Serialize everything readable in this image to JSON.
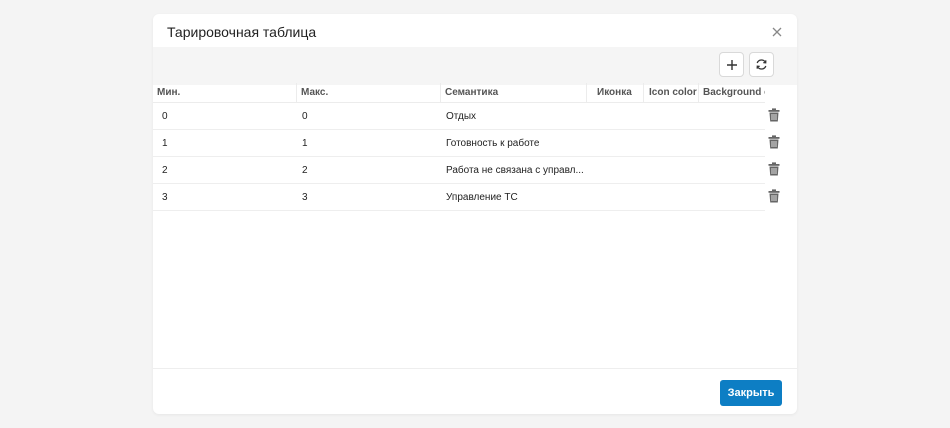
{
  "dialog": {
    "title": "Тарировочная таблица",
    "close_button_label": "Закрыть"
  },
  "toolbar": {
    "add_icon": "plus-icon",
    "refresh_icon": "refresh-icon"
  },
  "table": {
    "columns": [
      "Мин.",
      "Макс.",
      "Семантика",
      "Иконка",
      "Icon color",
      "Background c"
    ],
    "rows": [
      {
        "min": "0",
        "max": "0",
        "semantic": "Отдых"
      },
      {
        "min": "1",
        "max": "1",
        "semantic": "Готовность к работе"
      },
      {
        "min": "2",
        "max": "2",
        "semantic": "Работа не связана с управл..."
      },
      {
        "min": "3",
        "max": "3",
        "semantic": "Управление ТС"
      }
    ],
    "row_action_icon": "trash-icon"
  },
  "colors": {
    "primary": "#0d7ec4",
    "background": "#f4f4f4",
    "toolbar": "#f5f5f5"
  }
}
